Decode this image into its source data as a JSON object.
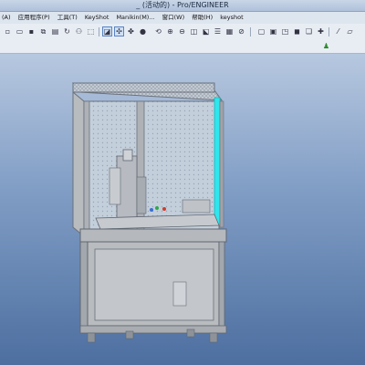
{
  "window": {
    "title": "_ (活动的) - Pro/ENGINEER"
  },
  "menubar": {
    "items": [
      "(A)",
      "应用程序(P)",
      "工具(T)",
      "KeyShot",
      "Manikin(M)...",
      "窗口(W)",
      "帮助(H)",
      "keyshot"
    ]
  },
  "toolbar": {
    "icons": [
      "new-icon",
      "open-icon",
      "save-icon",
      "copy-icon",
      "paste-icon",
      "regenerate-icon",
      "find-icon",
      "select-box-icon",
      "view-icon",
      "orient-icon",
      "spin-center-icon",
      "shading-icon",
      "refit-icon",
      "zoom-in-icon",
      "zoom-out-icon",
      "reorient-icon",
      "view-manager-icon",
      "layer-icon",
      "wireframe-icon",
      "hidden-line-icon",
      "no-hidden-icon",
      "shaded-icon",
      "datum-plane-icon",
      "axis-icon"
    ]
  },
  "colors": {
    "accent_cyan": "#2ee6ee",
    "frame_gray": "#b9bcbf",
    "background_top": "#b7c8e0",
    "background_bottom": "#4d6fa0"
  }
}
